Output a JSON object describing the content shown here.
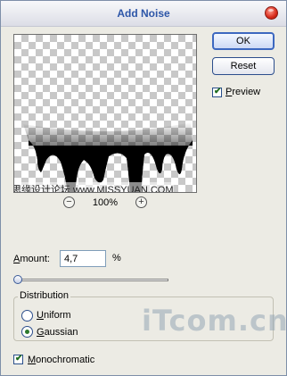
{
  "window": {
    "title": "Add Noise"
  },
  "preview": {
    "watermark": "思缘设计论坛 www.MISSYUAN.COM",
    "zoom_level": "100%"
  },
  "buttons": {
    "ok_label": "OK",
    "reset_label": "Reset"
  },
  "preview_toggle": {
    "label_prefix": "",
    "label_underline": "P",
    "label_rest": "review",
    "checked": true
  },
  "amount": {
    "label_underline": "A",
    "label_rest": "mount:",
    "value": "4,7",
    "unit": "%",
    "level_percent": 1.2
  },
  "distribution": {
    "title": "Distribution",
    "options": [
      {
        "underline": "U",
        "rest": "niform",
        "selected": false
      },
      {
        "underline": "G",
        "rest": "aussian",
        "selected": true
      }
    ]
  },
  "monochromatic": {
    "label_underline": "M",
    "label_rest": "onochromatic",
    "checked": true
  },
  "watermark_site": "iTcom.cn",
  "colors": {
    "title": "#2d56a8",
    "check": "#1d6b1d",
    "accent_border": "#3d68c0"
  }
}
